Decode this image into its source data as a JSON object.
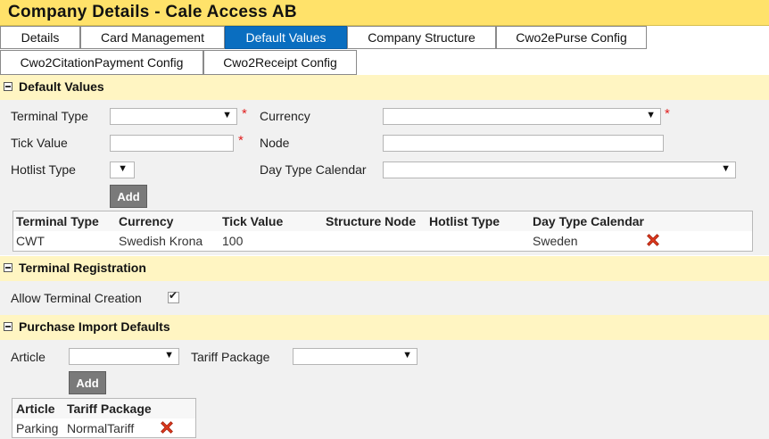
{
  "window": {
    "title": "Company Details - Cale Access AB"
  },
  "tabs": [
    {
      "label": "Details"
    },
    {
      "label": "Card Management"
    },
    {
      "label": "Default Values"
    },
    {
      "label": "Company Structure"
    },
    {
      "label": "Cwo2ePurse Config"
    },
    {
      "label": "Cwo2CitationPayment Config"
    },
    {
      "label": "Cwo2Receipt Config"
    }
  ],
  "active_tab": "Default Values",
  "default_values": {
    "heading": "Default Values",
    "terminal_type_label": "Terminal Type",
    "currency_label": "Currency",
    "tick_value_label": "Tick Value",
    "node_label": "Node",
    "hotlist_type_label": "Hotlist Type",
    "day_type_calendar_label": "Day Type Calendar",
    "required_marker": "*",
    "add_label": "Add",
    "grid_headers": [
      "Terminal Type",
      "Currency",
      "Tick Value",
      "Structure Node",
      "Hotlist Type",
      "Day Type Calendar"
    ],
    "rows": [
      {
        "terminal_type": "CWT",
        "currency": "Swedish Krona",
        "tick_value": "100",
        "structure_node": "",
        "hotlist_type": "",
        "day_type_calendar": "Sweden"
      }
    ]
  },
  "terminal_registration": {
    "heading": "Terminal Registration",
    "allow_label": "Allow Terminal Creation",
    "allow_checked": true
  },
  "purchase_import": {
    "heading": "Purchase Import Defaults",
    "article_label": "Article",
    "tariff_label": "Tariff Package",
    "add_label": "Add",
    "grid_headers": [
      "Article",
      "Tariff Package"
    ],
    "rows": [
      {
        "article": "Parking",
        "tariff_package": "NormalTariff"
      }
    ]
  },
  "icons": {
    "dropdown": "dropdown-arrow-icon",
    "delete": "delete-x-icon",
    "collapse": "collapse-icon",
    "check": "checkmark-icon"
  },
  "colors": {
    "title_bg": "#ffe26a",
    "section_bg": "#fff5c2",
    "active_tab": "#0a6ec0",
    "delete_red": "#e03a1e",
    "required": "#e02020"
  }
}
